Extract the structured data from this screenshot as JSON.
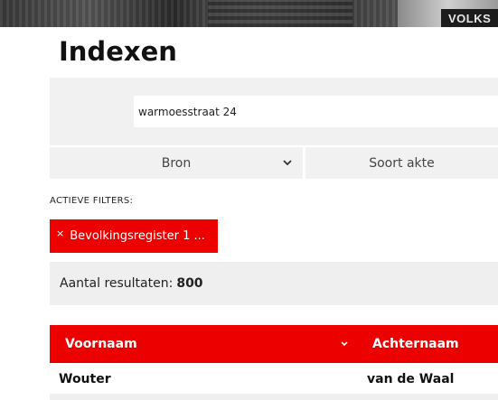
{
  "banner": {
    "sign_text": "VOLKS"
  },
  "page": {
    "title": "Indexen"
  },
  "search": {
    "value": "warmoesstraat 24"
  },
  "filters": {
    "bron_label": "Bron",
    "soort_akte_label": "Soort akte",
    "active_label": "ACTIEVE FILTERS:",
    "active": [
      {
        "remove_icon": "×",
        "label": "Bevolkingsregister 1 ..."
      }
    ]
  },
  "results": {
    "label": "Aantal resultaten:",
    "count": "800"
  },
  "table": {
    "columns": [
      "Voornaam",
      "Achternaam"
    ],
    "rows": [
      {
        "voornaam": "Wouter",
        "achternaam": "van de Waal"
      }
    ]
  },
  "colors": {
    "accent": "#ec0000",
    "panel": "#f1f1f1"
  },
  "icons": {
    "select_chevron": "chevron-down-icon",
    "sort": "sort-down-icon",
    "chip_remove": "close-icon"
  }
}
